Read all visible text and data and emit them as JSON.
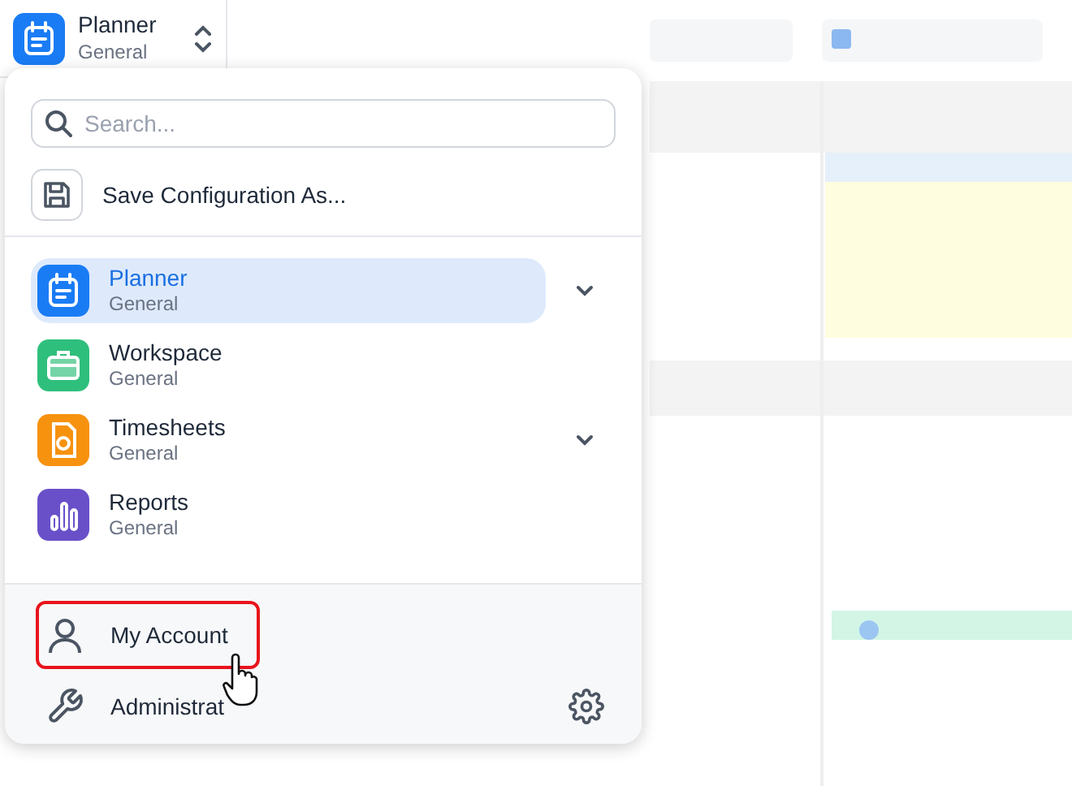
{
  "header": {
    "title": "Planner",
    "subtitle": "General"
  },
  "menu": {
    "search": {
      "placeholder": "Search..."
    },
    "save_configuration": "Save Configuration As...",
    "apps": [
      {
        "kind": "planner",
        "title": "Planner",
        "subtitle": "General",
        "selected": true,
        "expandable": true,
        "color": "#1a7cf5"
      },
      {
        "kind": "workspace",
        "title": "Workspace",
        "subtitle": "General",
        "selected": false,
        "expandable": false,
        "color": "#2fbf7c"
      },
      {
        "kind": "timesheets",
        "title": "Timesheets",
        "subtitle": "General",
        "selected": false,
        "expandable": true,
        "color": "#f7920f"
      },
      {
        "kind": "reports",
        "title": "Reports",
        "subtitle": "General",
        "selected": false,
        "expandable": false,
        "color": "#6950c9"
      }
    ],
    "footer": [
      {
        "kind": "account",
        "label": "My Account",
        "highlighted": true
      },
      {
        "kind": "admin",
        "label": "Administrat",
        "highlighted": false
      }
    ]
  }
}
